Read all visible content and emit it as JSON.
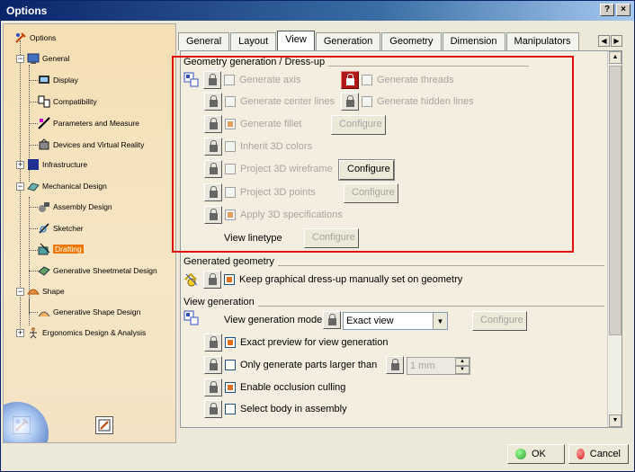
{
  "window": {
    "title": "Options",
    "help_glyph": "?",
    "close_glyph": "×"
  },
  "tree": [
    {
      "label": "Options",
      "icon": "options-icon"
    },
    {
      "label": "General",
      "icon": "general-icon"
    },
    {
      "label": "Display",
      "icon": "display-icon"
    },
    {
      "label": "Compatibility",
      "icon": "compatibility-icon"
    },
    {
      "label": "Parameters and Measure",
      "icon": "parameters-icon"
    },
    {
      "label": "Devices and Virtual Reality",
      "icon": "devices-icon"
    },
    {
      "label": "Infrastructure",
      "icon": "infrastructure-icon"
    },
    {
      "label": "Mechanical Design",
      "icon": "mechanical-design-icon"
    },
    {
      "label": "Assembly Design",
      "icon": "assembly-design-icon"
    },
    {
      "label": "Sketcher",
      "icon": "sketcher-icon"
    },
    {
      "label": "Drafting",
      "icon": "drafting-icon"
    },
    {
      "label": "Generative Sheetmetal Design",
      "icon": "sheetmetal-icon"
    },
    {
      "label": "Shape",
      "icon": "shape-icon"
    },
    {
      "label": "Generative Shape Design",
      "icon": "shape-design-icon"
    },
    {
      "label": "Ergonomics Design & Analysis",
      "icon": "ergonomics-icon"
    }
  ],
  "tabs": [
    "General",
    "Layout",
    "View",
    "Generation",
    "Geometry",
    "Dimension",
    "Manipulators"
  ],
  "active_tab": "View",
  "geometry_group": {
    "title": "Geometry generation / Dress-up",
    "generate_axis": "Generate axis",
    "generate_threads": "Generate threads",
    "generate_center_lines": "Generate center lines",
    "generate_hidden_lines": "Generate hidden lines",
    "generate_fillet": "Generate fillet",
    "inherit_3d_colors": "Inherit 3D colors",
    "project_3d_wireframe": "Project 3D wireframe",
    "project_3d_points": "Project 3D points",
    "apply_3d_specifications": "Apply 3D specifications",
    "view_linetype": "View linetype",
    "configure": "Configure"
  },
  "generated_group": {
    "title": "Generated geometry",
    "keep_dressup": "Keep graphical dress-up manually set on geometry"
  },
  "view_gen_group": {
    "title": "View generation",
    "mode_label": "View generation mode",
    "mode_value": "Exact view",
    "configure": "Configure",
    "exact_preview": "Exact preview for view generation",
    "only_larger": "Only generate parts larger than",
    "size_value": "1 mm",
    "occlusion": "Enable occlusion culling",
    "select_body": "Select body in assembly"
  },
  "footer": {
    "ok": "OK",
    "cancel": "Cancel"
  },
  "colors": {
    "selection": "#f07800",
    "highlight_box": "#e01010",
    "ok_dot": "#2a9d2a",
    "cancel_dot": "#d02020"
  }
}
